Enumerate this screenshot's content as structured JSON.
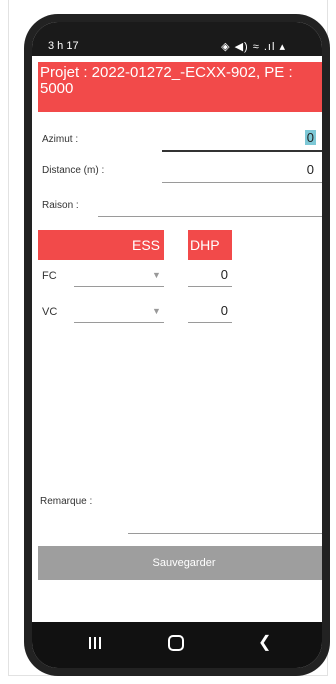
{
  "status_bar": {
    "time": "3 h 17",
    "icons_text": "◈ ◀) ≈ .ıl ▴"
  },
  "header": {
    "project_title": "Projet : 2022-01272_-ECXX-902, PE : 5000"
  },
  "form": {
    "azimut_label": "Azimut :",
    "azimut_value": "0",
    "distance_label": "Distance (m) :",
    "distance_value": "0",
    "raison_label": "Raison :",
    "raison_value": ""
  },
  "table": {
    "ess_header": "ESS",
    "dhp_header": "DHP",
    "rows": [
      {
        "label": "FC",
        "species": "",
        "dhp": "0"
      },
      {
        "label": "VC",
        "species": "",
        "dhp": "0"
      }
    ]
  },
  "remarque": {
    "label": "Remarque :",
    "value": ""
  },
  "actions": {
    "save_label": "Sauvegarder"
  },
  "nav": {
    "recents": "recents-icon",
    "home": "home-icon",
    "back": "back-icon"
  },
  "colors": {
    "accent_red": "#f24a4a",
    "button_gray": "#9e9e9e",
    "selection": "#7dc8d6"
  }
}
